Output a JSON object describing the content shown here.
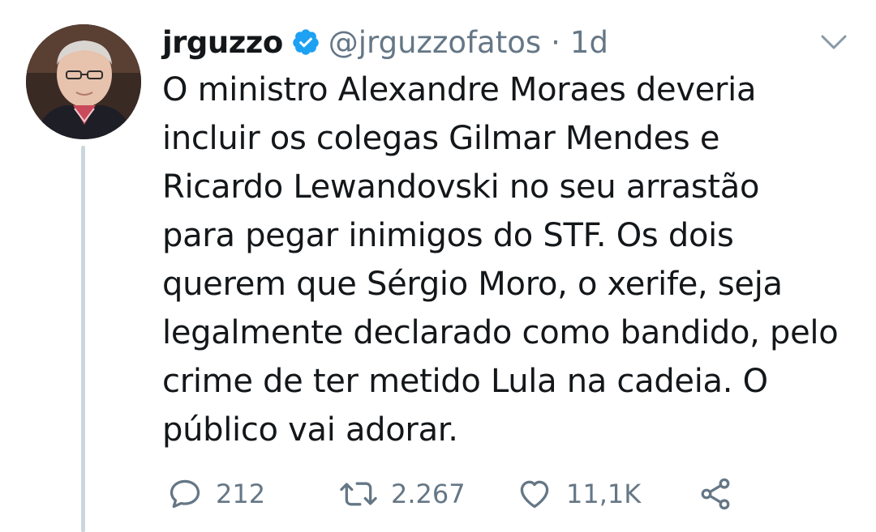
{
  "author": {
    "display_name": "jrguzzo",
    "handle": "@jrguzzofatos",
    "separator": "·",
    "time": "1d",
    "verified": true
  },
  "tweet": {
    "lines": [
      "O ministro Alexandre Moraes deveria",
      "incluir os colegas Gilmar Mendes e",
      "Ricardo Lewandovski no seu arrastão",
      "para pegar inimigos do STF. Os dois",
      "querem que Sérgio Moro, o xerife, seja",
      "legalmente declarado como bandido, pelo",
      "crime de ter metido Lula na cadeia. O",
      "público vai adorar."
    ]
  },
  "actions": {
    "reply": {
      "icon": "reply-icon",
      "count": "212"
    },
    "retweet": {
      "icon": "retweet-icon",
      "count": "2.267"
    },
    "like": {
      "icon": "heart-icon",
      "count": "11,1K"
    },
    "share": {
      "icon": "share-icon"
    }
  },
  "colors": {
    "text": "#14171a",
    "muted": "#657786",
    "verified": "#1da1f2",
    "thread_line": "#ccd6dd"
  }
}
